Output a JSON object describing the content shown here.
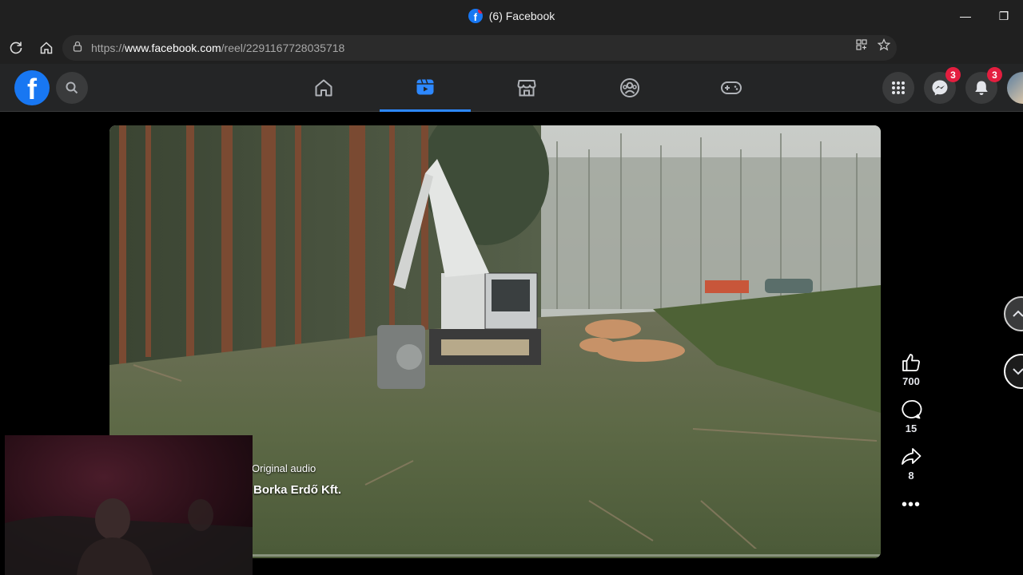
{
  "window": {
    "title": "(6) Facebook",
    "favicon_badge": ""
  },
  "browser": {
    "url_prefix": "https://",
    "url_domain": "www.facebook.com",
    "url_path": "/reel/2291167728035718"
  },
  "fbnav": {
    "messenger_badge": "3",
    "notifications_badge": "3",
    "accent": "#2d88ff"
  },
  "reel": {
    "audio": "Original audio",
    "author": "Borka Erdő Kft.",
    "likes": "700",
    "comments": "15",
    "shares": "8",
    "more": "•••"
  }
}
